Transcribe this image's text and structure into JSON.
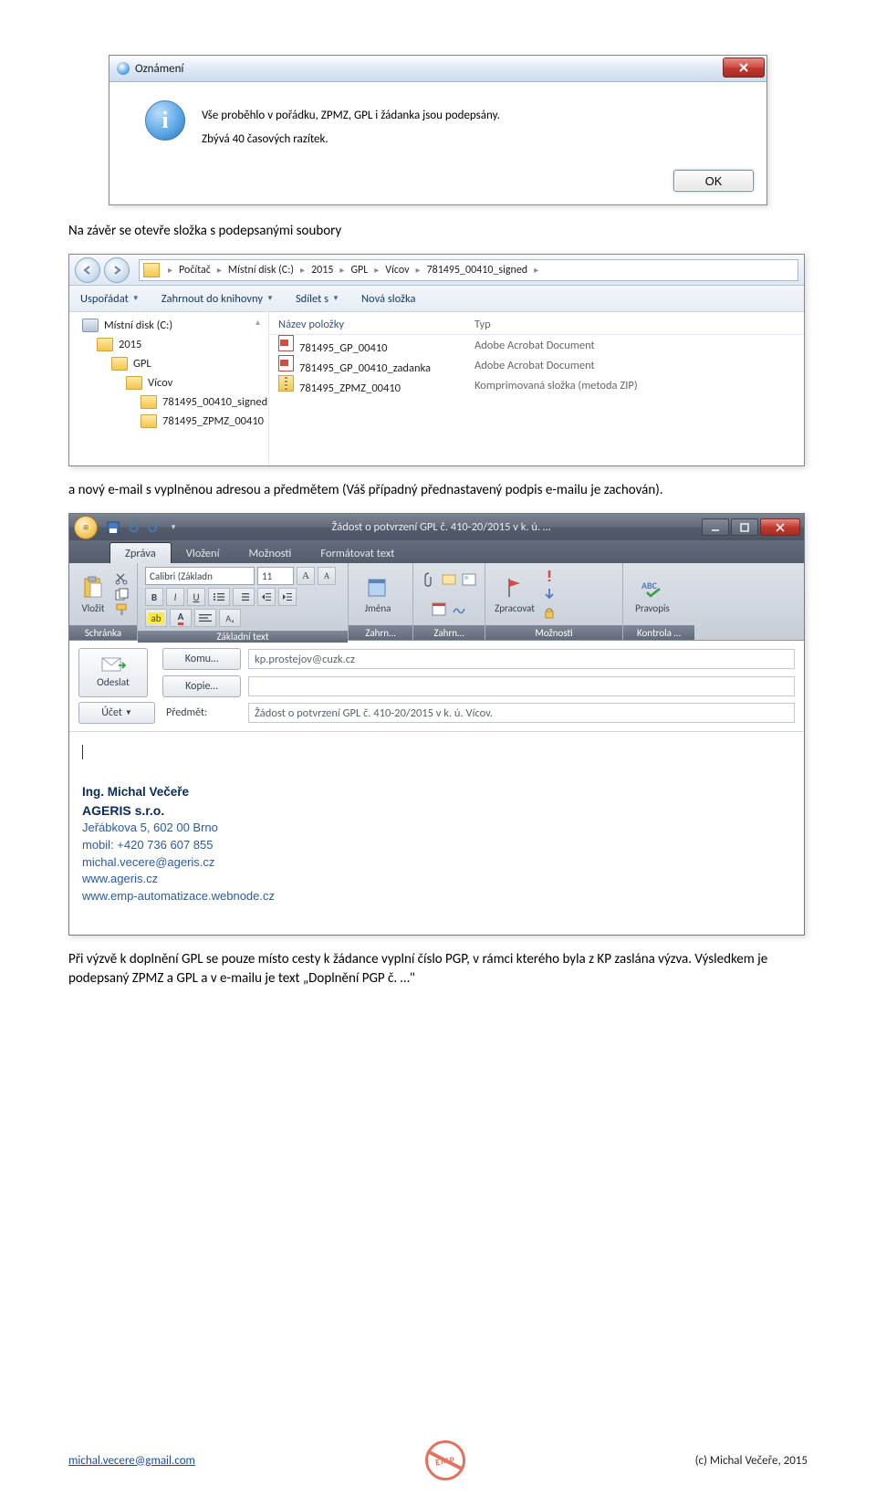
{
  "dialog": {
    "title": "Oznámení",
    "icon": "info-icon",
    "msg_line1": "Vše proběhlo v pořádku, ZPMZ, GPL i žádanka jsou podepsány.",
    "msg_line2": "Zbývá 40 časových razítek.",
    "ok_label": "OK"
  },
  "para1": "Na závěr se otevře složka s podepsanými soubory",
  "explorer": {
    "breadcrumbs": [
      "Počítač",
      "Místní disk (C:)",
      "2015",
      "GPL",
      "Vícov",
      "781495_00410_signed"
    ],
    "toolbar": {
      "arrange": "Uspořádat",
      "library": "Zahrnout do knihovny",
      "share": "Sdílet s",
      "newfolder": "Nová složka"
    },
    "tree": [
      {
        "label": "Místní disk (C:)",
        "indent": 14,
        "icon": "drive"
      },
      {
        "label": "2015",
        "indent": 30,
        "icon": "folder"
      },
      {
        "label": "GPL",
        "indent": 46,
        "icon": "folder"
      },
      {
        "label": "Vícov",
        "indent": 62,
        "icon": "folder"
      },
      {
        "label": "781495_00410_signed",
        "indent": 78,
        "icon": "folder"
      },
      {
        "label": "781495_ZPMZ_00410",
        "indent": 78,
        "icon": "folder"
      }
    ],
    "headers": {
      "name": "Název položky",
      "type": "Typ"
    },
    "files": [
      {
        "name": "781495_GP_00410",
        "type": "Adobe Acrobat Document",
        "icon": "pdf"
      },
      {
        "name": "781495_GP_00410_zadanka",
        "type": "Adobe Acrobat Document",
        "icon": "pdf"
      },
      {
        "name": "781495_ZPMZ_00410",
        "type": "Komprimovaná složka (metoda ZIP)",
        "icon": "zip"
      }
    ]
  },
  "para2": "a nový e-mail s vyplněnou adresou a předmětem (Váš případný přednastavený podpis e-mailu je zachován).",
  "outlook": {
    "window_title": "Žádost o potvrzení GPL č. 410-20/2015 v k. ú. …",
    "tabs": {
      "zprava": "Zpráva",
      "vlozeni": "Vložení",
      "moznosti": "Možnosti",
      "format": "Formátovat text"
    },
    "ribbon": {
      "vlozit": "Vložit",
      "schranka": "Schránka",
      "font_name": "Calibri (Základn",
      "font_sz": "11",
      "zakladni": "Základní text",
      "jmena": "Jména",
      "zahrn": "Zahrn…",
      "zpracovat": "Zpracovat",
      "moznosti_g": "Možnosti",
      "pravopis": "Pravopis",
      "kontrola": "Kontrola …"
    },
    "addr": {
      "odeslat": "Odeslat",
      "komu": "Komu…",
      "kopie": "Kopie…",
      "ucet": "Účet",
      "predmet": "Předmět:",
      "to_val": "kp.prostejov@cuzk.cz",
      "cc_val": "",
      "subject_val": "Žádost o potvrzení GPL č. 410-20/2015 v k. ú. Vícov."
    },
    "signature": {
      "name": "Ing. Michal Večeře",
      "firm": "AGERIS s.r.o.",
      "addr": "Jeřábkova 5, 602 00 Brno",
      "mobil": "mobil:  +420 736 607 855",
      "mail": "michal.vecere@ageris.cz",
      "web1": "www.ageris.cz",
      "web2": "www.emp-automatizace.webnode.cz"
    }
  },
  "para3": "Při výzvě k doplnění GPL se pouze místo cesty k žádance vyplní číslo PGP, v rámci kterého byla z KP zaslána výzva. Výsledkem je podepsaný ZPMZ a GPL a v e-mailu je text „Doplnění PGP č. …\"",
  "footer": {
    "left": "michal.vecere@gmail.com",
    "stamp": "EMP",
    "right": "(c)  Michal Večeře, 2015"
  }
}
